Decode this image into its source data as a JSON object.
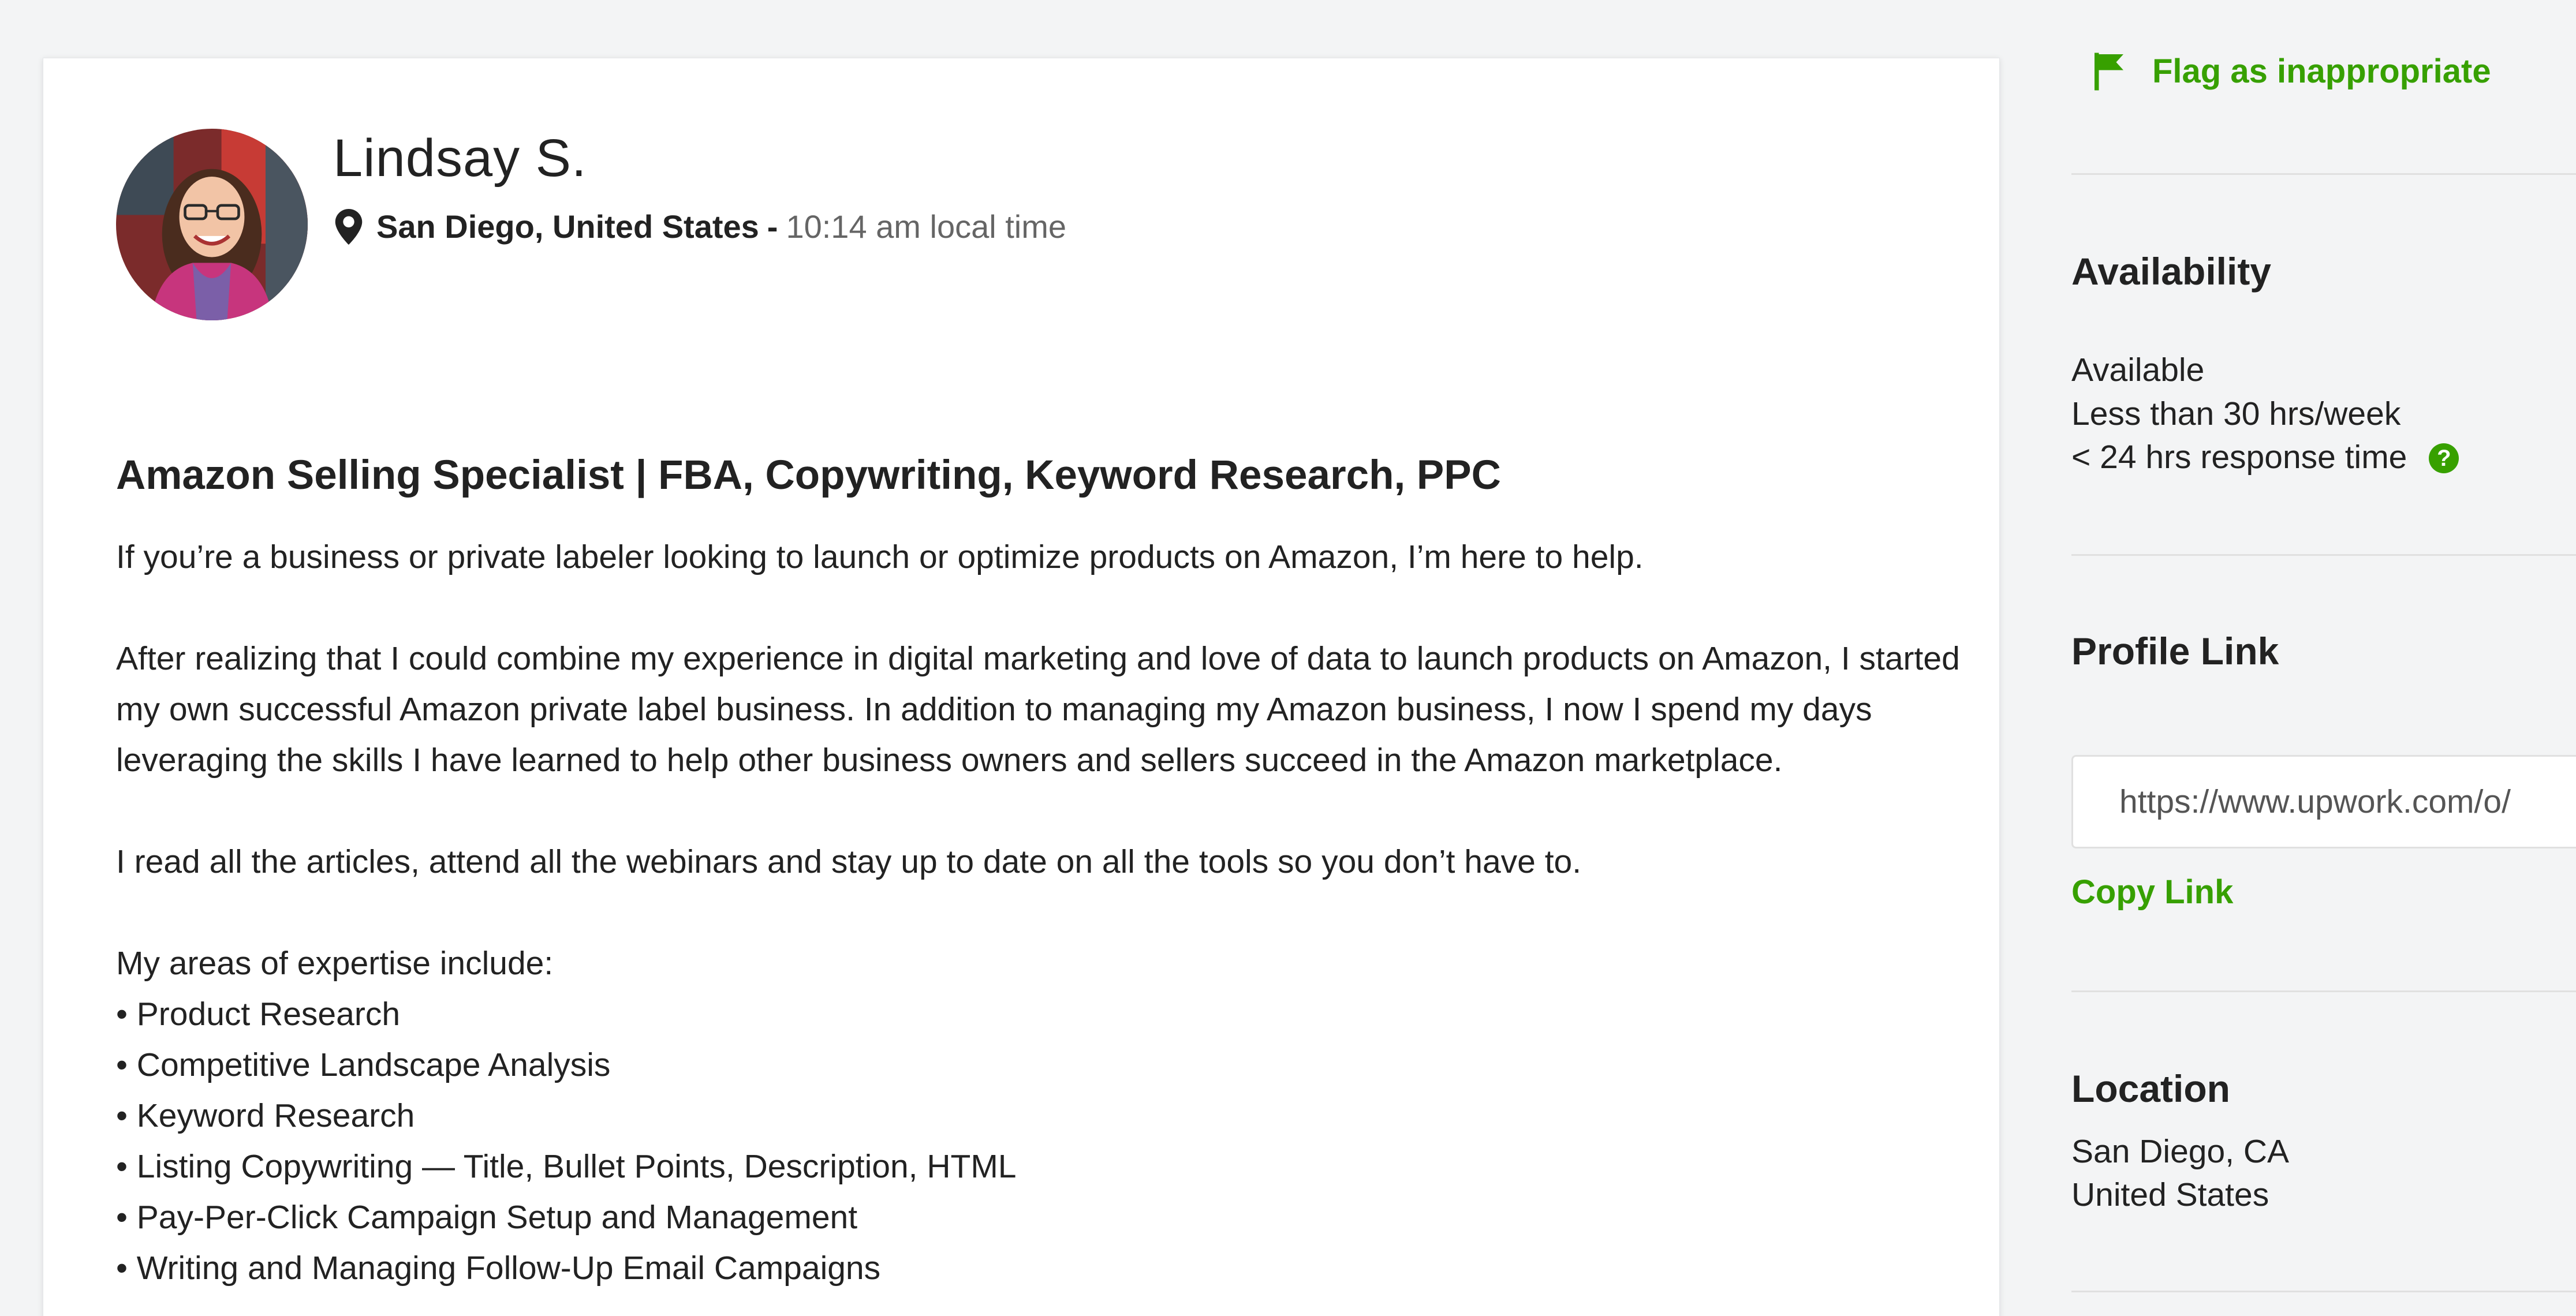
{
  "profile": {
    "name": "Lindsay S.",
    "location": "San Diego, United States",
    "location_separator": "-",
    "local_time": "10:14 am local time"
  },
  "overview": {
    "headline": "Amazon Selling Specialist | FBA, Copywriting, Keyword Research, PPC",
    "paragraphs": [
      "If you’re a business or private labeler looking to launch or optimize products on Amazon, I’m here to help.",
      "After realizing that I could combine my experience in digital marketing and love of data to launch products on Amazon, I started my own successful Amazon private label business. In addition to managing my Amazon business, I now I spend my days leveraging the skills I have learned to help other business owners and sellers succeed in the Amazon marketplace.",
      "I read all the articles, attend all the webinars and stay up to date on all the tools so you don’t have to."
    ],
    "expertise_intro": "My areas of expertise include:",
    "expertise": [
      "• Product Research",
      "• Competitive Landscape Analysis",
      "• Keyword Research",
      "• Listing Copywriting — Title, Bullet Points, Description, HTML",
      "• Pay-Per-Click Campaign Setup and Management",
      "• Writing and Managing Follow-Up Email Campaigns"
    ]
  },
  "sidebar": {
    "flag_label": "Flag as inappropriate",
    "availability": {
      "heading": "Availability",
      "status": "Available",
      "hours": "Less than 30 hrs/week",
      "response": "< 24 hrs response time",
      "help_glyph": "?"
    },
    "profile_link": {
      "heading": "Profile Link",
      "url": "https://www.upwork.com/o/",
      "copy_label": "Copy Link"
    },
    "location": {
      "heading": "Location",
      "city": "San Diego, CA",
      "country": "United States"
    }
  },
  "icons": {
    "pin": "map-pin-icon",
    "flag": "flag-icon",
    "help": "question-circle-icon"
  },
  "colors": {
    "accent": "#37a000",
    "background": "#f3f4f5",
    "card": "#ffffff",
    "muted_text": "#656565"
  }
}
